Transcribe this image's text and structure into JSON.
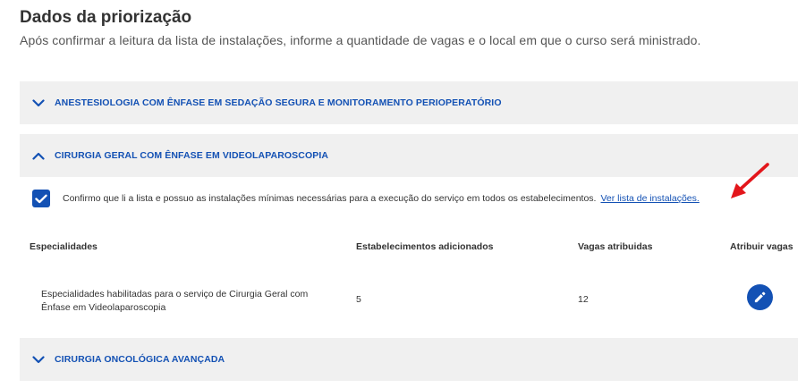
{
  "header": {
    "title": "Dados da priorização",
    "subtitle": "Após confirmar a leitura da lista de instalações, informe a quantidade de vagas e o local em que o curso será ministrado."
  },
  "accordions": [
    {
      "label": "ANESTESIOLOGIA COM ÊNFASE EM SEDAÇÃO SEGURA E MONITORAMENTO PERIOPERATÓRIO",
      "expanded": false
    },
    {
      "label": "CIRURGIA GERAL COM ÊNFASE EM VIDEOLAPAROSCOPIA",
      "expanded": true
    },
    {
      "label": "CIRURGIA ONCOLÓGICA AVANÇADA",
      "expanded": false
    }
  ],
  "confirm": {
    "checked": true,
    "text": "Confirmo que li a lista e possuo as instalações mínimas necessárias para a execução do serviço em todos os estabelecimentos.",
    "link": "Ver lista de instalações."
  },
  "table": {
    "headers": [
      "Especialidades",
      "Estabelecimentos adicionados",
      "Vagas atribuidas",
      "Atribuir vagas"
    ],
    "rows": [
      {
        "especialidade": "Especialidades habilitadas para o serviço de Cirurgia Geral com Ênfase em Videolaparoscopia",
        "estabelecimentos": "5",
        "vagas": "12",
        "action_icon": "pencil-icon"
      }
    ]
  },
  "colors": {
    "accent": "#1351b4",
    "panel": "#f0f0f0",
    "annotation_arrow": "#e3161b"
  }
}
